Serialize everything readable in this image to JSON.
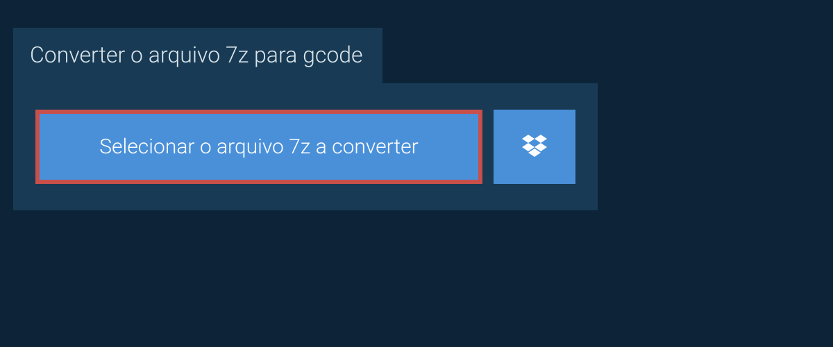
{
  "tab": {
    "title": "Converter o arquivo 7z para gcode"
  },
  "panel": {
    "select_button_label": "Selecionar o arquivo 7z a converter"
  }
}
